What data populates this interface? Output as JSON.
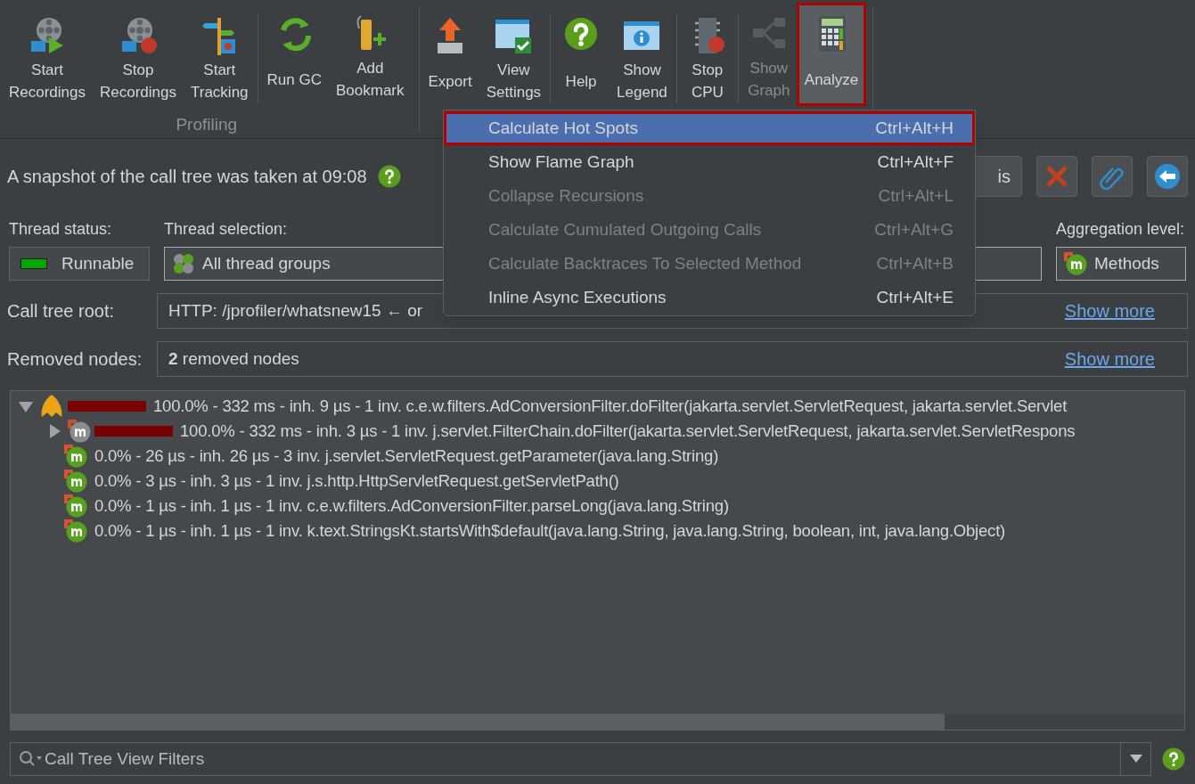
{
  "toolbar": {
    "groups": [
      {
        "label": "Profiling",
        "sections": [
          [
            {
              "label": "Start\nRecordings",
              "disabled": false,
              "pressed": false
            },
            {
              "label": "Stop\nRecordings",
              "disabled": false,
              "pressed": false
            },
            {
              "label": "Start\nTracking",
              "disabled": false,
              "pressed": false
            }
          ],
          [
            {
              "label": "Run GC",
              "disabled": false,
              "pressed": false
            },
            {
              "label": "Add\nBookmark",
              "disabled": false,
              "pressed": false
            }
          ]
        ]
      },
      {
        "sections": [
          [
            {
              "label": "Export",
              "disabled": false,
              "pressed": false
            },
            {
              "label": "View\nSettings",
              "disabled": false,
              "pressed": false
            }
          ],
          [
            {
              "label": "Help",
              "disabled": false,
              "pressed": false
            },
            {
              "label": "Show\nLegend",
              "disabled": false,
              "pressed": false
            }
          ],
          [
            {
              "label": "Stop\nCPU",
              "disabled": false,
              "pressed": false
            }
          ],
          [
            {
              "label": "Show\nGraph",
              "disabled": true,
              "pressed": false
            },
            {
              "label": "Analyze",
              "disabled": false,
              "pressed": true
            }
          ]
        ]
      }
    ]
  },
  "snapshot": {
    "text": "A snapshot of the call tree was taken at 09:08"
  },
  "action_buttons": [
    {
      "label": "is"
    }
  ],
  "thread_status": {
    "label": "Thread status:",
    "value": "Runnable",
    "color": "#00a800"
  },
  "thread_selection": {
    "label": "Thread selection:",
    "value": "All thread groups"
  },
  "aggregation": {
    "label": "Aggregation level:",
    "value": "Methods"
  },
  "call_tree_root": {
    "label": "Call tree root:",
    "value": "HTTP: /jprofiler/whatsnew15 ← or",
    "link": "Show more"
  },
  "removed_nodes": {
    "label": "Removed nodes:",
    "value": "**2** removed nodes",
    "link": "Show more"
  },
  "tree": [
    {
      "kind": "root",
      "expanded": true,
      "bar": true,
      "text": "100.0% - 332 ms - inh. 9 µs - 1 inv. c.e.w.filters.AdConversionFilter.doFilter(jakarta.servlet.ServletRequest, jakarta.servlet.Servlet",
      "children": [
        {
          "kind": "method_greyed",
          "expanded": false,
          "bar": true,
          "text": "100.0% - 332 ms - inh. 3 µs - 1 inv. j.servlet.FilterChain.doFilter(jakarta.servlet.ServletRequest, jakarta.servlet.ServletRespons"
        },
        {
          "kind": "method",
          "text": "0.0% - 26 µs - inh. 26 µs - 3 inv. j.servlet.ServletRequest.getParameter(java.lang.String)"
        },
        {
          "kind": "method",
          "text": "0.0% - 3 µs - inh. 3 µs - 1 inv. j.s.http.HttpServletRequest.getServletPath()"
        },
        {
          "kind": "method",
          "text": "0.0% - 1 µs - inh. 1 µs - 1 inv. c.e.w.filters.AdConversionFilter.parseLong(java.lang.String)"
        },
        {
          "kind": "method",
          "text": "0.0% - 1 µs - inh. 1 µs - 1 inv. k.text.StringsKt.startsWith$default(java.lang.String, java.lang.String, boolean, int, java.lang.Object)"
        }
      ]
    }
  ],
  "filter": {
    "placeholder": "Call Tree View Filters"
  },
  "menu": {
    "items": [
      {
        "label": "Calculate Hot Spots",
        "shortcut": "Ctrl+Alt+H",
        "disabled": false,
        "selected": true
      },
      {
        "label": "Show Flame Graph",
        "shortcut": "Ctrl+Alt+F",
        "disabled": false,
        "selected": false
      },
      {
        "label": "Collapse Recursions",
        "shortcut": "Ctrl+Alt+L",
        "disabled": true,
        "selected": false
      },
      {
        "label": "Calculate Cumulated Outgoing Calls",
        "shortcut": "Ctrl+Alt+G",
        "disabled": true,
        "selected": false
      },
      {
        "label": "Calculate Backtraces To Selected Method",
        "shortcut": "Ctrl+Alt+B",
        "disabled": true,
        "selected": false
      },
      {
        "label": "Inline Async Executions",
        "shortcut": "Ctrl+Alt+E",
        "disabled": false,
        "selected": false
      }
    ]
  }
}
